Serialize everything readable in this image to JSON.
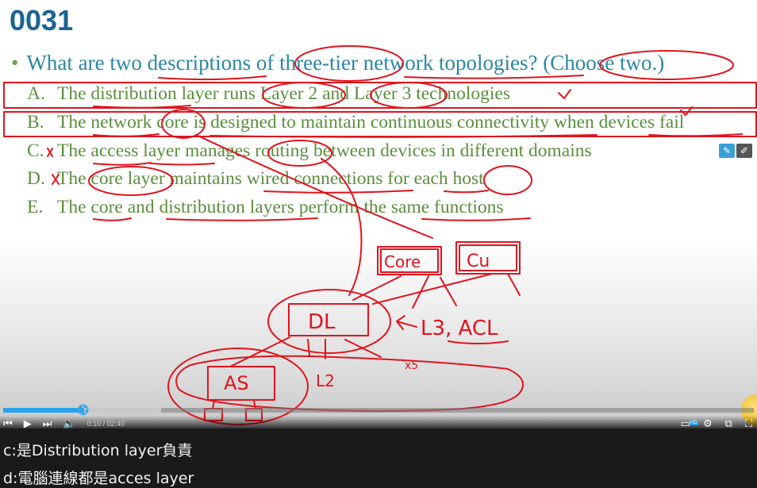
{
  "slide": {
    "title": "0031",
    "question_bullet": "•",
    "question": "What are two descriptions of three-tier network topologies? (Choose two.)",
    "options": [
      {
        "letter": "A.",
        "text": "The distribution layer runs Layer 2 and Layer 3 technologies"
      },
      {
        "letter": "B.",
        "text": "The network core is designed to maintain continuous connectivity when devices fail"
      },
      {
        "letter": "C.",
        "text": "The access layer manages routing between devices in different domains"
      },
      {
        "letter": "D.",
        "text": "The core layer maintains wired connections for each host"
      },
      {
        "letter": "E.",
        "text": "The core and distribution layers perform the same functions"
      }
    ]
  },
  "ink": {
    "color": "#e0141e",
    "labels": {
      "core": "Core",
      "cu": "Cu",
      "dl": "DL",
      "l3acl": "L3, ACL",
      "as": "AS",
      "l2": "L2",
      "x5": "x5"
    }
  },
  "player": {
    "progress_fraction": 0.108,
    "buffer_fraction": 0.21,
    "time_display": "0:10 / 02:40",
    "accent": "#27a3ec",
    "icons": [
      "skip-back-icon",
      "play-icon",
      "skip-next-icon",
      "volume-icon",
      "subtitles-icon",
      "settings-icon",
      "miniplayer-icon",
      "fullscreen-icon"
    ],
    "hd": "HD"
  },
  "captions": [
    "c:是Distribution layer負責",
    "d:電腦連線都是acces layer"
  ]
}
